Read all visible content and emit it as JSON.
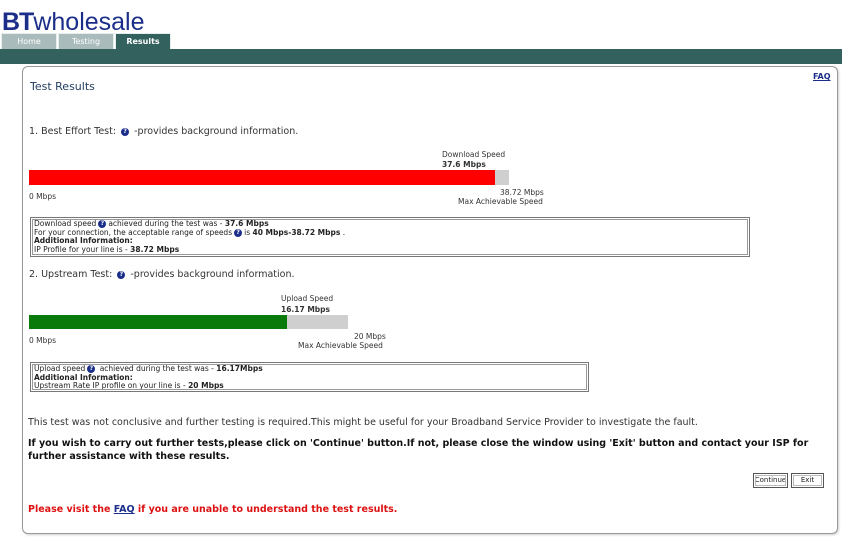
{
  "brand": {
    "bt": "BT",
    "wholesale": "wholesale"
  },
  "tabs": [
    {
      "label": "Home"
    },
    {
      "label": "Testing"
    },
    {
      "label": "Results"
    }
  ],
  "faq_link": "FAQ",
  "title": "Test Results",
  "best_effort": {
    "heading": "1. Best Effort Test:",
    "help_icon": "help-icon",
    "heading_suffix": "-provides background information.",
    "speed_caption": "Download Speed",
    "speed_value": "37.6 Mbps",
    "min_label": "0 Mbps",
    "max_value": "38.72 Mbps",
    "max_caption": "Max Achievable Speed",
    "fill_fraction": 0.971,
    "fill_color": "#ff0000",
    "info": {
      "line1_text": "Download speed",
      "line1_mid": "achieved during the test was - ",
      "line1_value": "37.6 Mbps",
      "line2_text": "For your connection, the acceptable range of speeds",
      "line2_mid": "is ",
      "line2_value": "40 Mbps-38.72 Mbps",
      "line2_end": " .",
      "line3": "Additional Information:",
      "line4_text": "IP Profile for your line is - ",
      "line4_value": "38.72 Mbps"
    }
  },
  "upstream": {
    "heading": "2. Upstream Test:",
    "help_icon": "help-icon",
    "heading_suffix": "-provides background information.",
    "speed_caption": "Upload Speed",
    "speed_value": "16.17 Mbps",
    "min_label": "0 Mbps",
    "max_value": "20 Mbps",
    "max_caption": "Max Achievable Speed",
    "fill_fraction": 0.8085,
    "fill_color": "#0a7a0a",
    "info": {
      "line1_text": "Upload speed",
      "line1_mid": " achieved during the test was - ",
      "line1_value": "16.17Mbps",
      "line2": "Additional Information:",
      "line3_text": "Upstream Rate IP profile on your line is - ",
      "line3_value": "20 Mbps"
    }
  },
  "message": "This test was not conclusive and further testing is required.This might be useful for your Broadband Service Provider to investigate the fault.",
  "instruction": "If you wish to carry out further tests,please click on 'Continue' button.If not, please close the window using 'Exit' button and contact your ISP for further assistance with these results.",
  "buttons": {
    "continue": "Continue",
    "exit": "Exit"
  },
  "visit": {
    "prefix": "Please visit the ",
    "link": "FAQ",
    "suffix": " if you are unable to understand the test results."
  }
}
